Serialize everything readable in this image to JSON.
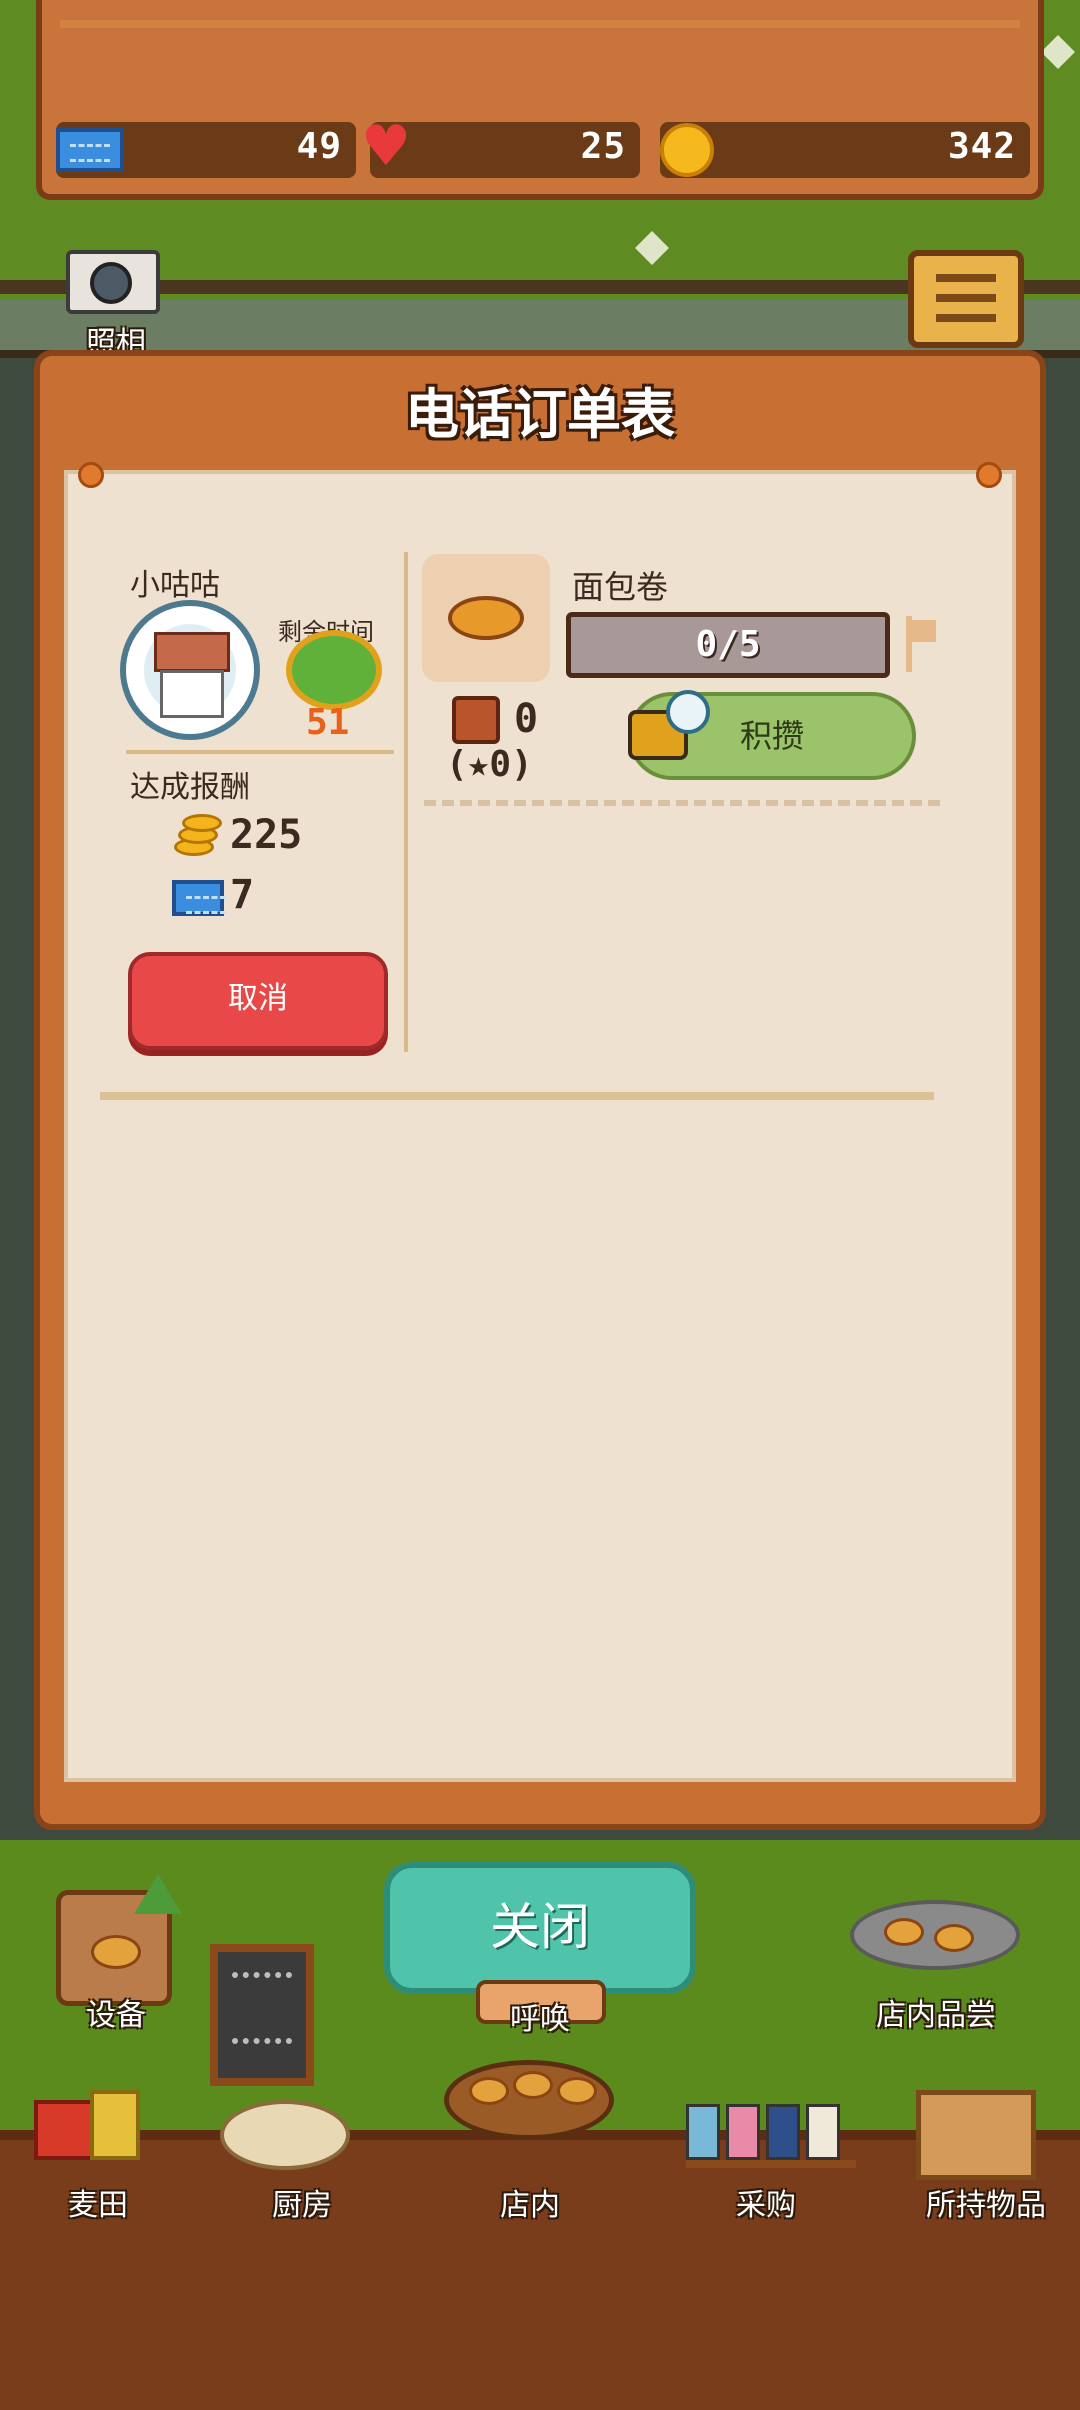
{
  "stats": {
    "tickets": "49",
    "hearts": "25",
    "coins": "342"
  },
  "camera": {
    "label": "照相"
  },
  "dialog": {
    "title": "电话订单表",
    "customer": {
      "name": "小咕咕",
      "time_label": "剩余时间",
      "time_remaining": "51"
    },
    "reward": {
      "label": "达成报酬",
      "coins": "225",
      "tickets": "7"
    },
    "cancel_label": "取消",
    "order": {
      "item_name": "面包卷",
      "progress": "0/5",
      "progress_fraction": 0,
      "stock": "0",
      "star_stock": "(★0)",
      "stockpile_label": "积攒"
    }
  },
  "bottom": {
    "close_label": "关闭",
    "equipment_label": "设备",
    "call_label": "呼唤",
    "tasting_label": "店内品尝",
    "nav": [
      {
        "label": "麦田"
      },
      {
        "label": "厨房"
      },
      {
        "label": "店内"
      },
      {
        "label": "采购"
      },
      {
        "label": "所持物品"
      }
    ]
  },
  "colors": {
    "accent_green": "#4fc4aa",
    "cancel_red": "#e84848",
    "stockpile_green": "#9bc46a",
    "timer_orange": "#e8621b"
  }
}
